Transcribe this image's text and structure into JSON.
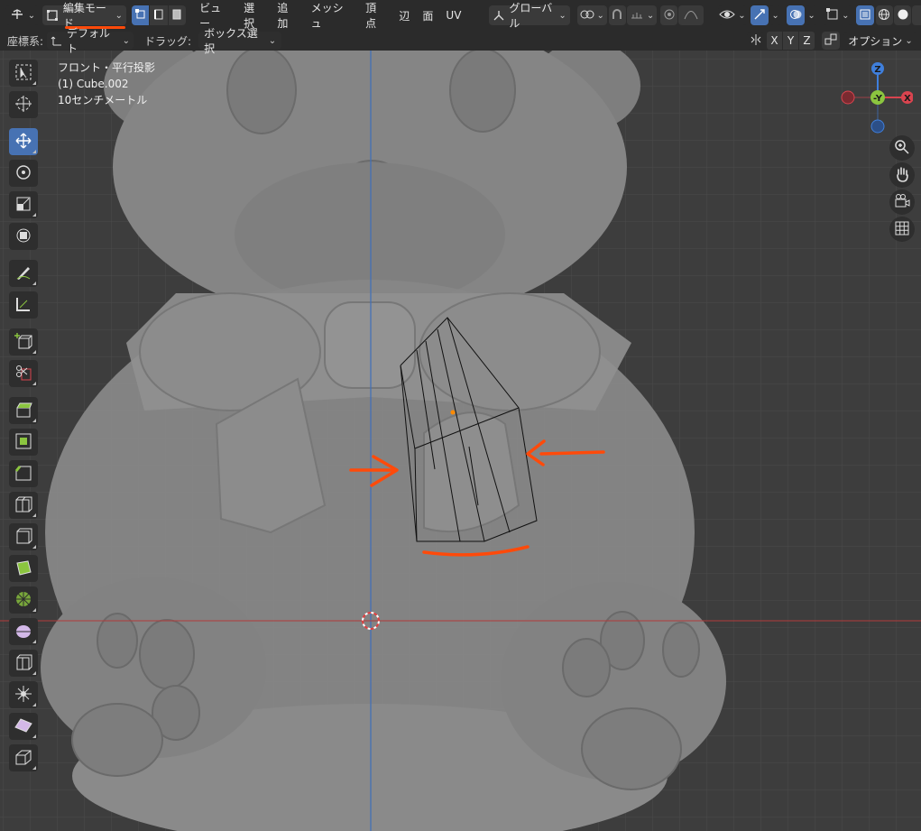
{
  "header": {
    "mode_label": "編集モード",
    "menus": [
      "ビュー",
      "選択",
      "追加",
      "メッシュ",
      "頂点",
      "辺",
      "面",
      "UV"
    ],
    "orientation_label": "グローバル"
  },
  "subheader": {
    "coord_label": "座標系:",
    "coord_value": "デフォルト",
    "drag_label": "ドラッグ:",
    "drag_value": "ボックス選択",
    "axis_x": "X",
    "axis_y": "Y",
    "axis_z": "Z",
    "options_label": "オプション"
  },
  "viewport": {
    "view_name": "フロント・平行投影",
    "object_name": "(1) Cube.002",
    "scale_label": "10センチメートル"
  },
  "gizmo": {
    "z_label": "Z",
    "y_label": "-Y",
    "x_label": "X"
  },
  "colors": {
    "header_bg": "#2b2b2b",
    "viewport_bg": "#3d3d3d",
    "accent_blue": "#4772b3",
    "annotation_orange": "#ff4a0a",
    "x_axis_red": "#d9444f",
    "y_axis_green": "#8bc53f",
    "z_axis_blue": "#3f7fdc"
  },
  "icons": [
    "editor-type-icon",
    "edit-mode-icon",
    "vertex-select-icon",
    "edge-select-icon",
    "face-select-icon",
    "orientation-icon",
    "pivot-icon",
    "snap-icon",
    "proportional-icon",
    "visibility-icon",
    "gizmo-icon",
    "overlay-icon",
    "xray-icon",
    "shading-wireframe-icon",
    "shading-solid-icon",
    "select-box-tool-icon",
    "cursor-tool-icon",
    "move-tool-icon",
    "rotate-tool-icon",
    "scale-tool-icon",
    "transform-tool-icon",
    "annotate-tool-icon",
    "measure-tool-icon",
    "add-cube-tool-icon",
    "knife-tool-icon",
    "extrude-tool-icon",
    "inset-tool-icon",
    "bevel-tool-icon",
    "loop-cut-tool-icon",
    "offset-edge-tool-icon",
    "poly-build-tool-icon",
    "spin-tool-icon",
    "smooth-tool-icon",
    "edge-slide-tool-icon",
    "shrink-fatten-tool-icon",
    "shear-tool-icon",
    "rip-tool-icon",
    "zoom-icon",
    "hand-icon",
    "camera-icon",
    "grid-icon"
  ]
}
